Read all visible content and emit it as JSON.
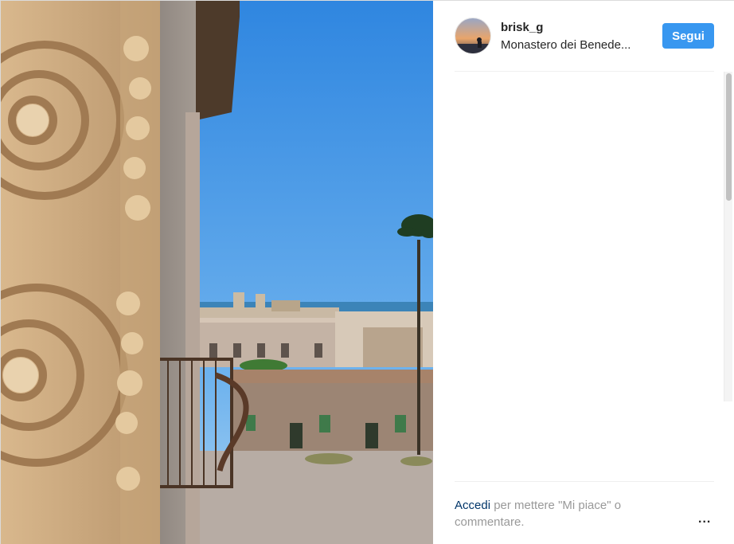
{
  "post": {
    "username": "brisk_g",
    "location": "Monastero dei Benede...",
    "follow_label": "Segui"
  },
  "footer": {
    "login_link": "Accedi",
    "login_rest": " per mettere \"Mi piace\" o commentare.",
    "more_label": "..."
  },
  "icons": {
    "more": "more-options-icon",
    "avatar": "profile-avatar"
  },
  "colors": {
    "accent": "#3897f0",
    "link": "#003569",
    "muted": "#999999",
    "sky": "#4f9fe8"
  }
}
